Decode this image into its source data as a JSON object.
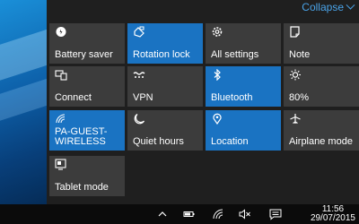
{
  "panel": {
    "collapse_label": "Collapse"
  },
  "tiles": [
    {
      "label": "Battery saver",
      "icon": "battery-saver-icon",
      "active": false
    },
    {
      "label": "Rotation lock",
      "icon": "rotation-lock-icon",
      "active": true
    },
    {
      "label": "All settings",
      "icon": "gear-icon",
      "active": false
    },
    {
      "label": "Note",
      "icon": "note-icon",
      "active": false
    },
    {
      "label": "Connect",
      "icon": "connect-icon",
      "active": false
    },
    {
      "label": "VPN",
      "icon": "vpn-icon",
      "active": false
    },
    {
      "label": "Bluetooth",
      "icon": "bluetooth-icon",
      "active": true
    },
    {
      "label": "80%",
      "icon": "brightness-icon",
      "active": false
    },
    {
      "label": "PA-GUEST-WIRELESS",
      "label_line1": "PA-GUEST-",
      "label_line2": "WIRELESS",
      "icon": "wifi-icon",
      "active": true
    },
    {
      "label": "Quiet hours",
      "icon": "moon-icon",
      "active": false
    },
    {
      "label": "Location",
      "icon": "location-icon",
      "active": true
    },
    {
      "label": "Airplane mode",
      "icon": "airplane-icon",
      "active": false
    },
    {
      "label": "Tablet mode",
      "icon": "tablet-mode-icon",
      "active": false
    }
  ],
  "taskbar": {
    "time": "11:56",
    "date": "29/07/2015",
    "tray_icons": [
      "chevron-up-icon",
      "battery-icon",
      "wifi-icon",
      "volume-muted-icon",
      "action-center-icon"
    ]
  },
  "colors": {
    "tile_active": "#1a73c2",
    "tile_inactive": "#3c3c3c",
    "panel_bg": "#1f1f1f",
    "accent_text": "#4aa3e8"
  }
}
